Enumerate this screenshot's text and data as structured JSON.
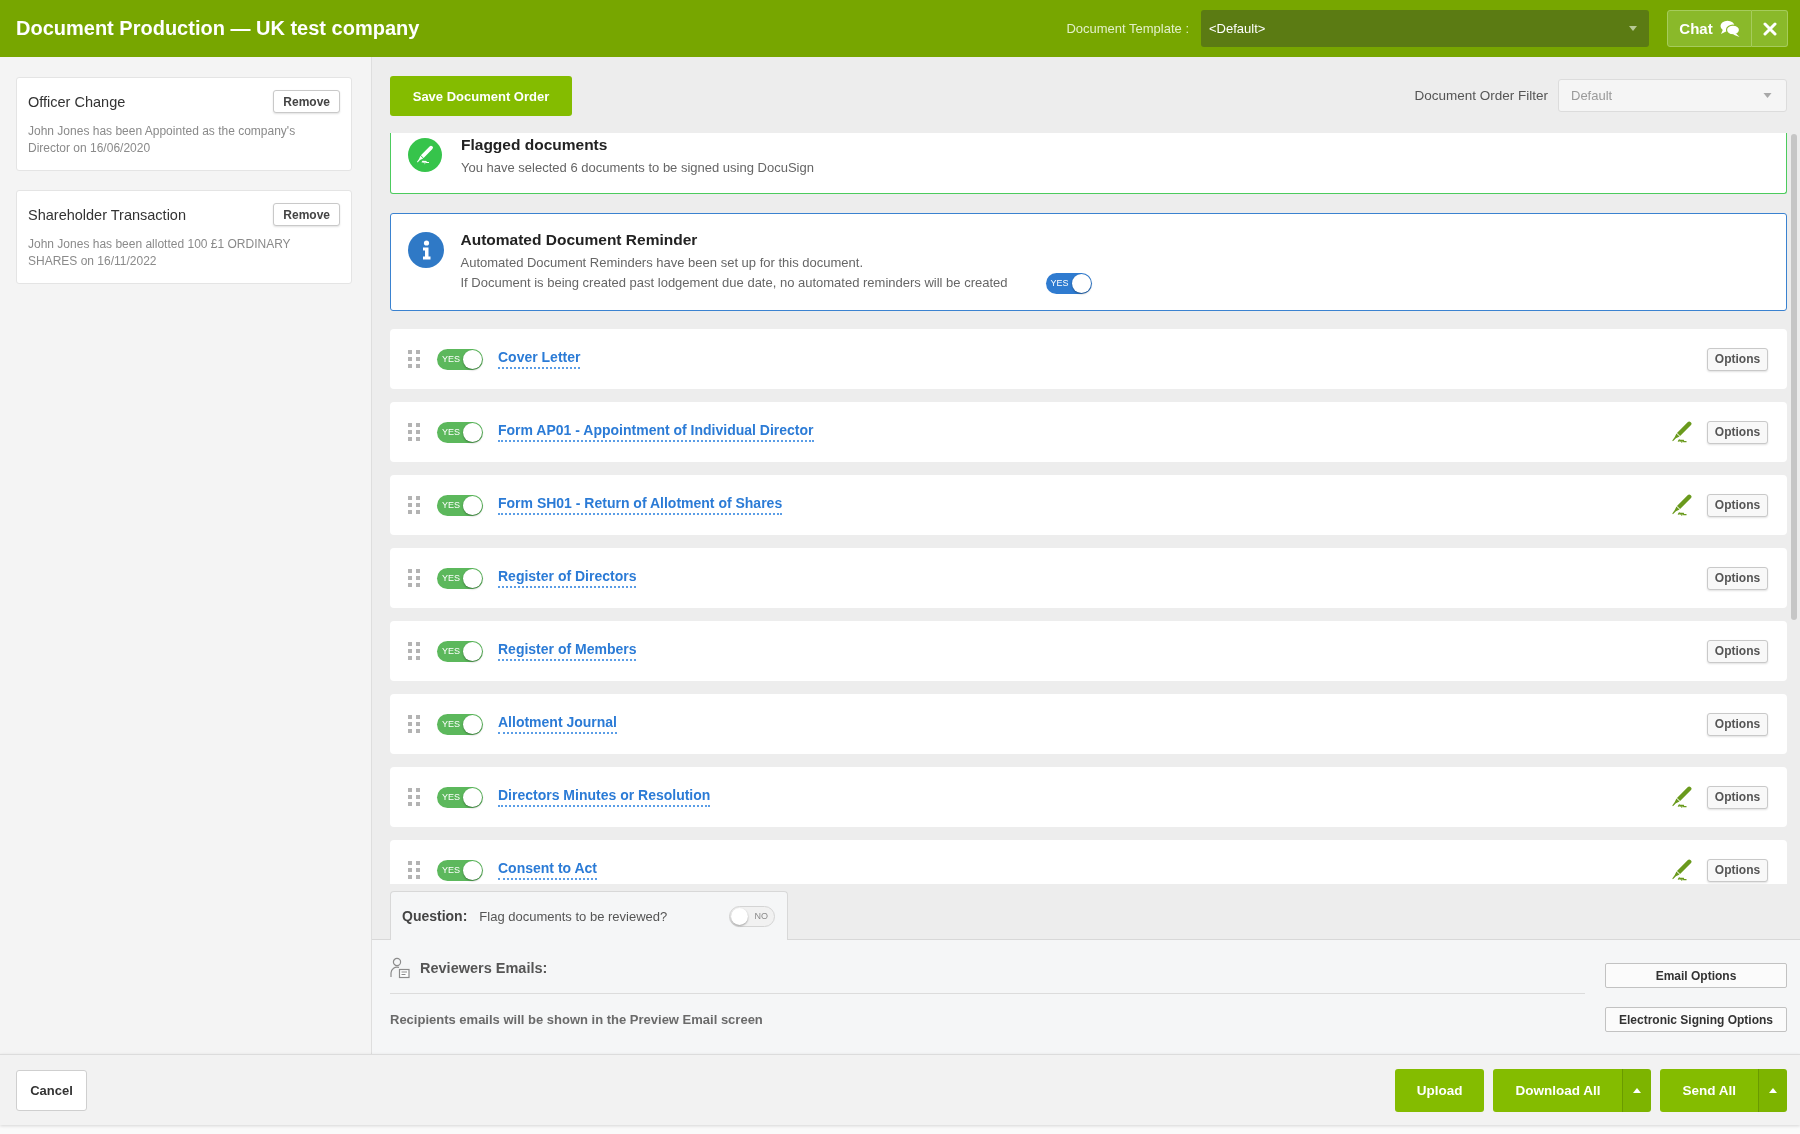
{
  "header": {
    "title": "Document Production — UK test company",
    "template_label": "Document Template :",
    "template_value": "<Default>",
    "chat_button": "Chat"
  },
  "sidebar": {
    "events": [
      {
        "title": "Officer Change",
        "button": "Remove",
        "description": "John Jones has been Appointed as the company's Director on 16/06/2020"
      },
      {
        "title": "Shareholder Transaction",
        "button": "Remove",
        "description": "John Jones has been allotted 100 £1 ORDINARY SHARES on 16/11/2022"
      }
    ]
  },
  "toolbar": {
    "save_button": "Save Document Order",
    "filter_label": "Document Order Filter",
    "filter_value": "Default"
  },
  "notices": [
    {
      "kind": "flagged",
      "title": "Flagged documents",
      "lines": [
        "You have selected 6 documents to be signed using DocuSign"
      ]
    },
    {
      "kind": "info",
      "title": "Automated Document Reminder",
      "lines": [
        "Automated Document Reminders have been set up for this document.",
        "If Document is being created past lodgement due date, no automated reminders will be created"
      ],
      "toggle": {
        "label": "YES",
        "on": true
      }
    }
  ],
  "documents": [
    {
      "name": "Cover Letter",
      "toggle": {
        "label": "YES",
        "on": true
      },
      "signing": false,
      "options": "Options"
    },
    {
      "name": "Form AP01 - Appointment of Individual Director",
      "toggle": {
        "label": "YES",
        "on": true
      },
      "signing": true,
      "options": "Options"
    },
    {
      "name": "Form SH01 - Return of Allotment of Shares",
      "toggle": {
        "label": "YES",
        "on": true
      },
      "signing": true,
      "options": "Options"
    },
    {
      "name": "Register of Directors",
      "toggle": {
        "label": "YES",
        "on": true
      },
      "signing": false,
      "options": "Options"
    },
    {
      "name": "Register of Members",
      "toggle": {
        "label": "YES",
        "on": true
      },
      "signing": false,
      "options": "Options"
    },
    {
      "name": "Allotment Journal",
      "toggle": {
        "label": "YES",
        "on": true
      },
      "signing": false,
      "options": "Options"
    },
    {
      "name": "Directors Minutes or Resolution",
      "toggle": {
        "label": "YES",
        "on": true
      },
      "signing": true,
      "options": "Options"
    },
    {
      "name": "Consent to Act",
      "toggle": {
        "label": "YES",
        "on": true
      },
      "signing": true,
      "options": "Options"
    }
  ],
  "question": {
    "label": "Question:",
    "text": "Flag documents to be reviewed?",
    "toggle": {
      "label": "NO",
      "on": false
    }
  },
  "reviewers": {
    "title": "Reviewers Emails:",
    "note": "Recipients emails will be shown in the Preview Email screen",
    "buttons": [
      "Email Options",
      "Electronic Signing Options"
    ]
  },
  "footer": {
    "cancel": "Cancel",
    "actions": [
      {
        "label": "Upload",
        "menu": false
      },
      {
        "label": "Download All",
        "menu": true
      },
      {
        "label": "Send All",
        "menu": true
      }
    ]
  }
}
